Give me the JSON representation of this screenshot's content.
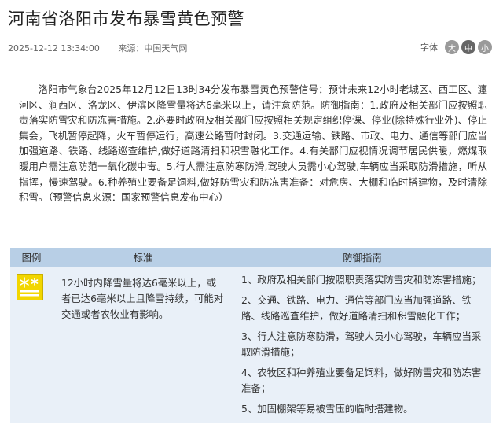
{
  "article": {
    "title": "河南省洛阳市发布暴雪黄色预警",
    "datetime": "2025-12-12 13:34:00",
    "source_label": "来源：",
    "source": "中国天气网",
    "font_size_label": "字体",
    "font_sizes": [
      "大",
      "中",
      "小"
    ],
    "body": "洛阳市气象台2025年12月12日13时34分发布暴雪黄色预警信号：预计未来12小时老城区、西工区、瀍河区、涧西区、洛龙区、伊滨区降雪量将达6毫米以上，请注意防范。防御指南：1.政府及相关部门应按照职责落实防雪灾和防冻害措施。2.必要时政府及相关部门应按照相关规定组织停课、停业(除特殊行业外)、停止集会，飞机暂停起降，火车暂停运行，高速公路暂时封闭。3.交通运输、铁路、市政、电力、通信等部门应当加强道路、铁路、线路巡查维护,做好道路清扫和积雪融化工作。4.有关部门应视情况调节居民供暖，燃煤取暖用户需注意防范一氧化碳中毒。5.行人需注意防寒防滑,驾驶人员需小心驾驶,车辆应当采取防滑措施，听从指挥，慢速驾驶。6.种养殖业要备足饲料,做好防雪灾和防冻害准备：对危房、大棚和临时搭建物，及时清除积雪。（预警信息来源：国家预警信息发布中心）"
  },
  "table": {
    "headers": [
      "图例",
      "标准",
      "防御指南"
    ],
    "icon": "snowstorm-yellow-warning-icon",
    "icon_color": "#f2d600",
    "standard": "12小时内降雪量将达6毫米以上，或者已达6毫米以上且降雪持续，可能对交通或者农牧业有影响。",
    "guidelines": [
      "1、政府及相关部门按照职责落实防雪灾和防冻害措施；",
      "2、交通、铁路、电力、通信等部门应当加强道路、铁路、线路巡查维护，做好道路清扫和积雪融化工作；",
      "3、行人注意防寒防滑，驾驶人员小心驾驶，车辆应当采取防滑措施；",
      "4、农牧区和种养殖业要备足饲料，做好防雪灾和防冻害准备；",
      "5、加固棚架等易被雪压的临时搭建物。"
    ]
  }
}
